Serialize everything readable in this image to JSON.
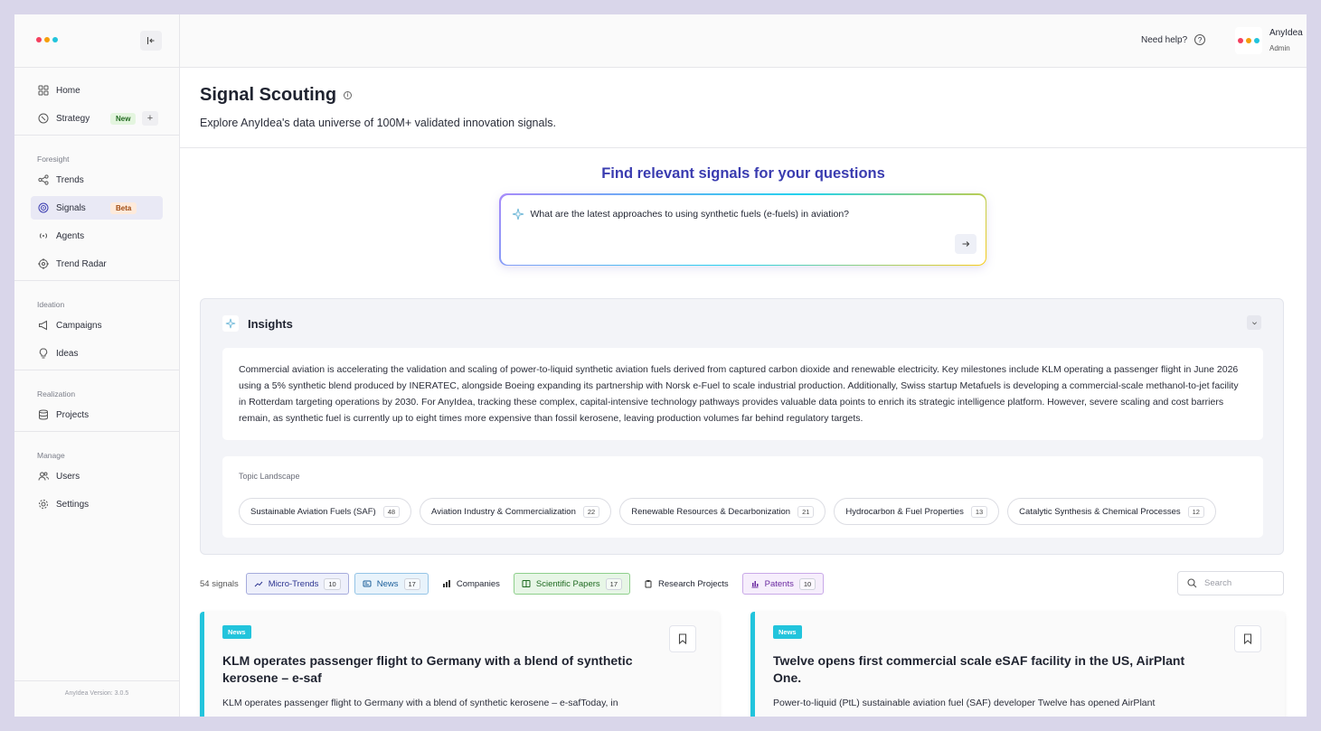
{
  "brand": {
    "colors": [
      "#f43f5e",
      "#f59e0b",
      "#22c4dc"
    ]
  },
  "sidebar": {
    "collapse_icon": "collapse-left-icon",
    "top_items": [
      {
        "label": "Home",
        "icon": "grid-icon"
      },
      {
        "label": "Strategy",
        "icon": "compass-icon",
        "badge": "New",
        "plus": "+"
      }
    ],
    "groups": [
      {
        "label": "Foresight",
        "items": [
          {
            "label": "Trends",
            "icon": "share-icon"
          },
          {
            "label": "Signals",
            "icon": "radar-icon",
            "badge": "Beta",
            "active": true
          },
          {
            "label": "Agents",
            "icon": "broadcast-icon"
          },
          {
            "label": "Trend Radar",
            "icon": "target-icon"
          }
        ]
      },
      {
        "label": "Ideation",
        "items": [
          {
            "label": "Campaigns",
            "icon": "megaphone-icon"
          },
          {
            "label": "Ideas",
            "icon": "lightbulb-icon"
          }
        ]
      },
      {
        "label": "Realization",
        "items": [
          {
            "label": "Projects",
            "icon": "database-icon"
          }
        ]
      },
      {
        "label": "Manage",
        "items": [
          {
            "label": "Users",
            "icon": "users-icon"
          },
          {
            "label": "Settings",
            "icon": "gear-icon"
          }
        ]
      }
    ],
    "version": "AnyIdea Version: 3.0.5"
  },
  "topbar": {
    "help": "Need help?",
    "user_name": "AnyIdea",
    "user_role": "Admin"
  },
  "page": {
    "title": "Signal Scouting",
    "subtitle": "Explore AnyIdea's data universe of 100M+ validated innovation signals."
  },
  "search": {
    "heading": "Find relevant signals for your questions",
    "query": "What are the latest approaches to using synthetic fuels (e-fuels) in aviation?"
  },
  "insights": {
    "title": "Insights",
    "text": "Commercial aviation is accelerating the validation and scaling of power-to-liquid synthetic aviation fuels derived from captured carbon dioxide and renewable electricity. Key milestones include KLM operating a passenger flight in June 2026 using a 5% synthetic blend produced by INERATEC, alongside Boeing expanding its partnership with Norsk e-Fuel to scale industrial production. Additionally, Swiss startup Metafuels is developing a commercial-scale methanol-to-jet facility in Rotterdam targeting operations by 2030. For AnyIdea, tracking these complex, capital-intensive technology pathways provides valuable data points to enrich its strategic intelligence platform. However, severe scaling and cost barriers remain, as synthetic fuel is currently up to eight times more expensive than fossil kerosene, leaving production volumes far behind regulatory targets.",
    "topic_label": "Topic Landscape",
    "topics": [
      {
        "label": "Sustainable Aviation Fuels (SAF)",
        "count": "48"
      },
      {
        "label": "Aviation Industry & Commercialization",
        "count": "22"
      },
      {
        "label": "Renewable Resources & Decarbonization",
        "count": "21"
      },
      {
        "label": "Hydrocarbon & Fuel Properties",
        "count": "13"
      },
      {
        "label": "Catalytic Synthesis & Chemical Processes",
        "count": "12"
      }
    ]
  },
  "filters": {
    "count_label": "54 signals",
    "items": [
      {
        "label": "Micro-Trends",
        "count": "10",
        "style": "f-micro",
        "icon": "chart-line-icon"
      },
      {
        "label": "News",
        "count": "17",
        "style": "f-news",
        "icon": "newspaper-icon"
      },
      {
        "label": "Companies",
        "count": "",
        "style": "f-plain",
        "icon": "bar-chart-icon"
      },
      {
        "label": "Scientific Papers",
        "count": "17",
        "style": "f-sci",
        "icon": "book-icon"
      },
      {
        "label": "Research Projects",
        "count": "",
        "style": "f-plain",
        "icon": "clipboard-icon"
      },
      {
        "label": "Patents",
        "count": "10",
        "style": "f-pat",
        "icon": "patent-chart-icon"
      }
    ],
    "search_placeholder": "Search"
  },
  "cards": [
    {
      "tag": "News",
      "title": "KLM operates passenger flight to Germany with a blend of synthetic kerosene – e-saf",
      "text": "KLM operates passenger flight to Germany with a blend of synthetic kerosene – e-safToday, in"
    },
    {
      "tag": "News",
      "title": "Twelve opens first commercial scale eSAF facility in the US, AirPlant One.",
      "text": "Power-to-liquid (PtL) sustainable aviation fuel (SAF) developer Twelve has opened AirPlant"
    }
  ]
}
